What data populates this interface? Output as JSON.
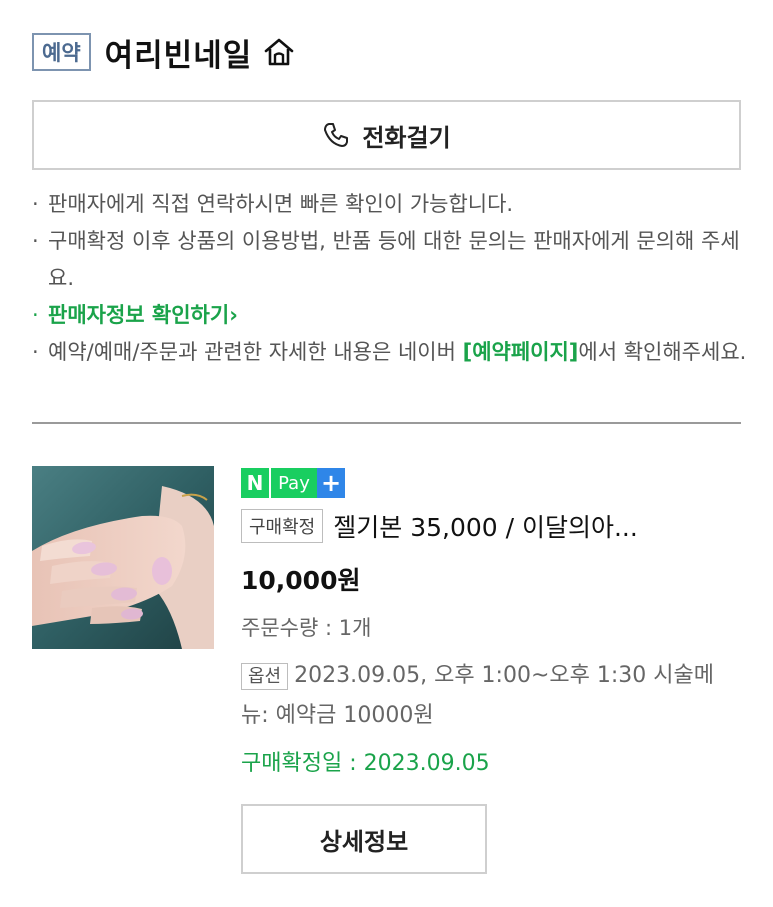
{
  "header": {
    "badge": "예약",
    "shop_name": "여리빈네일",
    "home_icon": "home-icon"
  },
  "call_button": {
    "label": "전화걸기",
    "icon": "phone-icon"
  },
  "notices": {
    "line1": "판매자에게 직접 연락하시면 빠른 확인이 가능합니다.",
    "line2": "구매확정 이후 상품의 이용방법, 반품 등에 대한 문의는 판매자에게 문의해 주세요.",
    "seller_link": "판매자정보 확인하기",
    "line4_prefix": "예약/예매/주문과 관련한 자세한 내용은 네이버 ",
    "line4_link": "[예약페이지]",
    "line4_suffix": "에서 확인해주세요."
  },
  "order": {
    "npay": {
      "n": "N",
      "pay": "Pay",
      "plus": "+"
    },
    "status": "구매확정",
    "title": "젤기본 35,000 / 이달의아...",
    "price": "10,000원",
    "quantity": "주문수량 : 1개",
    "option_tag": "옵션",
    "option_text": "2023.09.05, 오후 1:00~오후 1:30 시술메뉴: 예약금 10000원",
    "confirm_date": "구매확정일 : 2023.09.05",
    "detail_button": "상세정보"
  },
  "colors": {
    "green": "#1aa34a",
    "npay_green": "#19ce60",
    "npay_blue": "#2f86e8"
  }
}
